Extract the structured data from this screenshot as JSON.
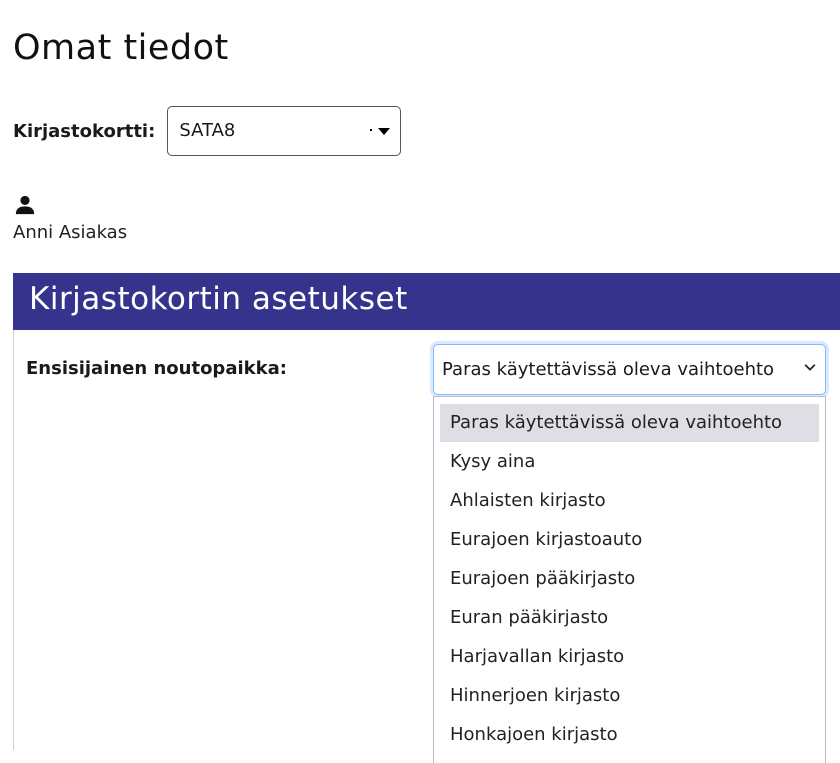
{
  "page": {
    "title": "Omat tiedot"
  },
  "library_card": {
    "label": "Kirjastokortti:",
    "selected_value": "SATA8"
  },
  "user": {
    "icon": "user-icon",
    "name": "Anni Asiakas"
  },
  "settings_section": {
    "title": "Kirjastokortin asetukset",
    "header_color": "#35338c",
    "pickup": {
      "label": "Ensisijainen noutopaikka:",
      "selected_value": "Paras käytettävissä oleva vaihtoehto",
      "options": [
        "Paras käytettävissä oleva vaihtoehto",
        "Kysy aina",
        "Ahlaisten kirjasto",
        "Eurajoen kirjastoauto",
        "Eurajoen pääkirjasto",
        "Euran pääkirjasto",
        "Harjavallan kirjasto",
        "Hinnerjoen kirjasto",
        "Honkajoen kirjasto"
      ],
      "highlighted_index": 0
    }
  }
}
